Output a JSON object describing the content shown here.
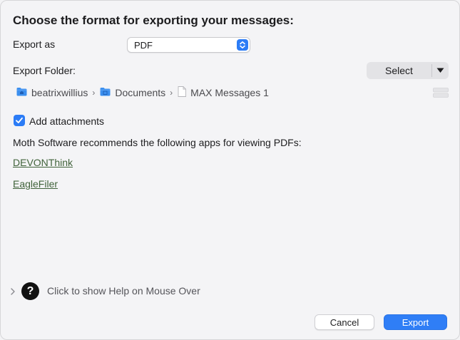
{
  "dialog": {
    "title": "Choose the format for exporting your messages:"
  },
  "export_as": {
    "label": "Export as",
    "selected": "PDF"
  },
  "export_folder": {
    "label": "Export Folder:",
    "select_button": "Select"
  },
  "path": {
    "segments": [
      {
        "label": "beatrixwillius",
        "icon": "home-folder-icon"
      },
      {
        "label": "Documents",
        "icon": "folder-icon"
      },
      {
        "label": "MAX Messages 1",
        "icon": "document-icon"
      }
    ]
  },
  "attachments": {
    "label": "Add attachments",
    "checked": true
  },
  "recommend": {
    "text": "Moth Software recommends the following apps for viewing PDFs:",
    "links": [
      "DEVONThink",
      "EagleFiler"
    ]
  },
  "help": {
    "text": "Click to show Help on Mouse Over",
    "icon_glyph": "?"
  },
  "buttons": {
    "cancel": "Cancel",
    "export": "Export"
  },
  "colors": {
    "accent": "#2c7cf6",
    "link": "#41633b",
    "folder": "#3b8fef"
  }
}
